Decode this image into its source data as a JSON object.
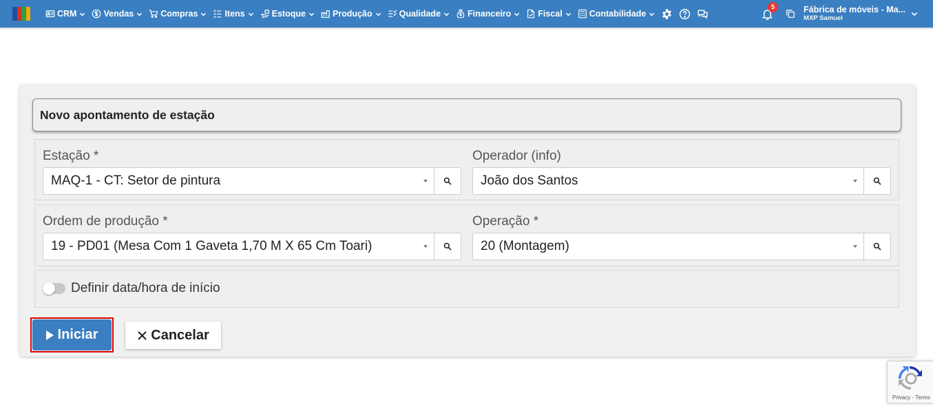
{
  "navbar": {
    "logo_colors": [
      "#1f4fa3",
      "#d93025",
      "#2e9e44",
      "#f2a900"
    ],
    "menu": [
      {
        "label": "CRM",
        "icon": "address-card-icon"
      },
      {
        "label": "Vendas",
        "icon": "dollar-circle-icon"
      },
      {
        "label": "Compras",
        "icon": "cart-icon"
      },
      {
        "label": "Itens",
        "icon": "list-items-icon"
      },
      {
        "label": "Estoque",
        "icon": "hand-box-icon"
      },
      {
        "label": "Produção",
        "icon": "factory-icon"
      },
      {
        "label": "Qualidade",
        "icon": "checklist-icon"
      },
      {
        "label": "Financeiro",
        "icon": "money-bag-icon"
      },
      {
        "label": "Fiscal",
        "icon": "document-icon"
      },
      {
        "label": "Contabilidade",
        "icon": "calculator-icon"
      }
    ],
    "notification_count": "5",
    "company_name": "Fábrica de móveis - Ma...",
    "company_user": "MXP Samuel"
  },
  "form": {
    "title": "Novo apontamento de estação",
    "station_label": "Estação *",
    "station_value": "MAQ-1 - CT: Setor de pintura",
    "operator_label": "Operador (info)",
    "operator_value": "João dos Santos",
    "order_label": "Ordem de produção *",
    "order_value": "19 - PD01 (Mesa Com 1 Gaveta 1,70 M X 65 Cm Toari)",
    "operation_label": "Operação *",
    "operation_value": "20 (Montagem)",
    "toggle_label": "Definir data/hora de início",
    "start_button": "Iniciar",
    "cancel_button": "Cancelar"
  },
  "recaptcha": {
    "text": "Privacy - Terms"
  },
  "colors": {
    "primary": "#3a7fc1",
    "highlight": "#e00000",
    "badge": "#e53935"
  }
}
